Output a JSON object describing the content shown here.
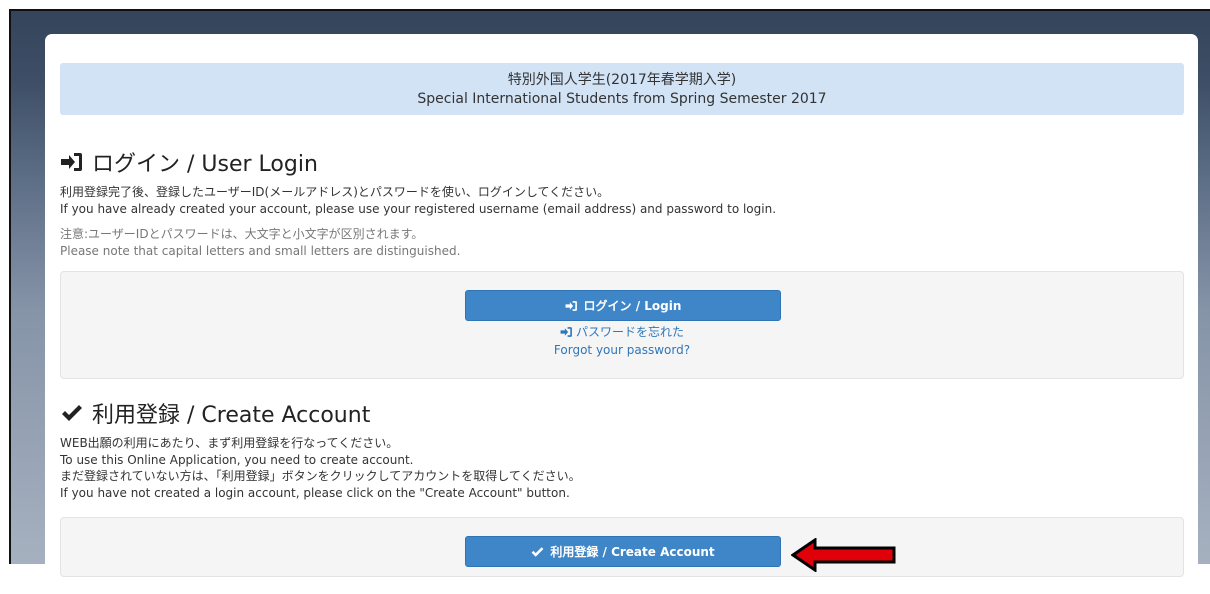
{
  "banner": {
    "title_ja": "特別外国人学生(2017年春学期入学)",
    "title_en": "Special International Students from Spring Semester 2017"
  },
  "login": {
    "heading": "ログイン / User Login",
    "desc_ja": "利用登録完了後、登録したユーザーID(メールアドレス)とパスワードを使い、ログインしてください。",
    "desc_en": "If you have already created your account, please use your registered username (email address) and password to login.",
    "note_ja": "注意:ユーザーIDとパスワードは、大文字と小文字が区別されます。",
    "note_en": "Please note that capital letters and small letters are distinguished.",
    "button_label": "ログイン / Login",
    "forgot_ja": "パスワードを忘れた",
    "forgot_en": "Forgot your password?"
  },
  "create": {
    "heading": "利用登録 / Create Account",
    "line1_ja": "WEB出願の利用にあたり、まず利用登録を行なってください。",
    "line1_en": "To use this Online Application, you need to create account.",
    "line2_ja": "まだ登録されていない方は、「利用登録」ボタンをクリックしてアカウントを取得してください。",
    "line2_en": "If you have not created a login account, please click on the \"Create Account\" button.",
    "button_label": "利用登録 / Create Account"
  },
  "colors": {
    "banner_bg": "#d2e3f6",
    "button_bg": "#3f86c9",
    "link": "#2e77bb",
    "arrow": "#e0000a"
  },
  "icons": {
    "login": "sign-in-icon",
    "create": "check-icon",
    "pointer": "left-arrow-icon"
  }
}
